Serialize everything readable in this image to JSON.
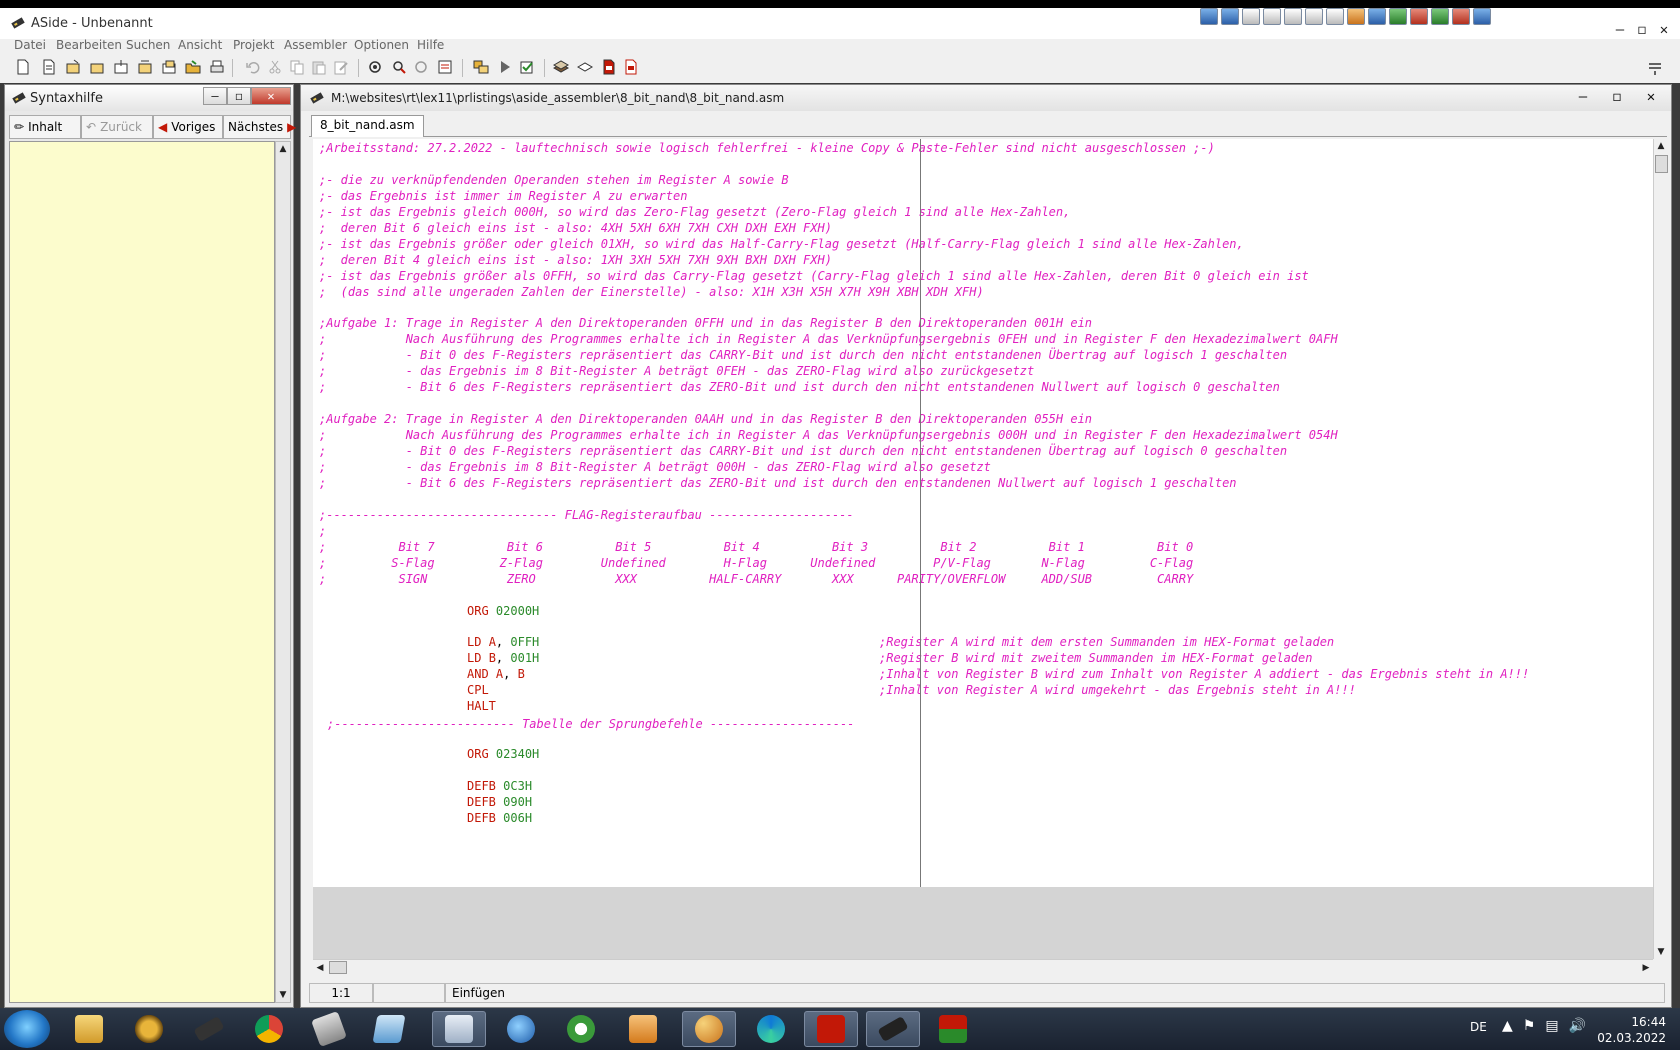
{
  "window": {
    "title": "ASide - Unbenannt"
  },
  "menu": [
    "Datei",
    "Bearbeiten",
    "Suchen",
    "Ansicht",
    "Projekt",
    "Assembler",
    "Optionen",
    "Hilfe"
  ],
  "syntax_panel": {
    "title": "Syntaxhilfe",
    "nav": {
      "contents": "Inhalt",
      "back": "Zurück",
      "previous": "Voriges",
      "next": "Nächstes"
    }
  },
  "editor": {
    "path": "M:\\websites\\rt\\lex11\\prlistings\\aside_assembler\\8_bit_nand\\8_bit_nand.asm",
    "tab": "8_bit_nand.asm",
    "comment_lines": [
      ";Arbeitsstand: 27.2.2022 - lauftechnisch sowie logisch fehlerfrei - kleine Copy & Paste-Fehler sind nicht ausgeschlossen ;-)",
      "",
      ";- die zu verknüpfendenden Operanden stehen im Register A sowie B",
      ";- das Ergebnis ist immer im Register A zu erwarten",
      ";- ist das Ergebnis gleich 000H, so wird das Zero-Flag gesetzt (Zero-Flag gleich 1 sind alle Hex-Zahlen,",
      ";  deren Bit 6 gleich eins ist - also: 4XH 5XH 6XH 7XH CXH DXH EXH FXH)",
      ";- ist das Ergebnis größer oder gleich 01XH, so wird das Half-Carry-Flag gesetzt (Half-Carry-Flag gleich 1 sind alle Hex-Zahlen,",
      ";  deren Bit 4 gleich eins ist - also: 1XH 3XH 5XH 7XH 9XH BXH DXH FXH)",
      ";- ist das Ergebnis größer als 0FFH, so wird das Carry-Flag gesetzt (Carry-Flag gleich 1 sind alle Hex-Zahlen, deren Bit 0 gleich ein ist",
      ";  (das sind alle ungeraden Zahlen der Einerstelle) - also: X1H X3H X5H X7H X9H XBH XDH XFH)",
      "",
      ";Aufgabe 1: Trage in Register A den Direktoperanden 0FFH und in das Register B den Direktoperanden 001H ein",
      ";           Nach Ausführung des Programmes erhalte ich in Register A das Verknüpfungsergebnis 0FEH und in Register F den Hexadezimalwert 0AFH",
      ";           - Bit 0 des F-Registers repräsentiert das CARRY-Bit und ist durch den nicht entstandenen Übertrag auf logisch 1 geschalten",
      ";           - das Ergebnis im 8 Bit-Register A beträgt 0FEH - das ZERO-Flag wird also zurückgesetzt",
      ";           - Bit 6 des F-Registers repräsentiert das ZERO-Bit und ist durch den nicht entstandenen Nullwert auf logisch 0 geschalten",
      "",
      ";Aufgabe 2: Trage in Register A den Direktoperanden 0AAH und in das Register B den Direktoperanden 055H ein",
      ";           Nach Ausführung des Programmes erhalte ich in Register A das Verknüpfungsergebnis 000H und in Register F den Hexadezimalwert 054H",
      ";           - Bit 0 des F-Registers repräsentiert das CARRY-Bit und ist durch den nicht entstandenen Übertrag auf logisch 0 geschalten",
      ";           - das Ergebnis im 8 Bit-Register A beträgt 000H - das ZERO-Flag wird also gesetzt",
      ";           - Bit 6 des F-Registers repräsentiert das ZERO-Bit und ist durch den entstandenen Nullwert auf logisch 1 geschalten",
      "",
      ";-------------------------------- FLAG-Registeraufbau --------------------",
      ";",
      ";          Bit 7          Bit 6          Bit 5          Bit 4          Bit 3          Bit 2          Bit 1          Bit 0",
      ";         S-Flag         Z-Flag        Undefined        H-Flag      Undefined        P/V-Flag       N-Flag         C-Flag",
      ";          SIGN           ZERO           XXX          HALF-CARRY       XXX      PARITY/OVERFLOW     ADD/SUB         CARRY"
    ],
    "code1": [
      {
        "mn": "ORG",
        "args": [
          {
            "t": "num",
            "v": "02000H"
          }
        ]
      },
      {
        "mn": "",
        "args": []
      },
      {
        "mn": "LD",
        "args": [
          {
            "t": "op",
            "v": "A"
          },
          {
            "t": "sep",
            "v": ", "
          },
          {
            "t": "num",
            "v": "0FFH"
          }
        ]
      },
      {
        "mn": "LD",
        "args": [
          {
            "t": "op",
            "v": "B"
          },
          {
            "t": "sep",
            "v": ", "
          },
          {
            "t": "num",
            "v": "001H"
          }
        ]
      },
      {
        "mn": "AND",
        "args": [
          {
            "t": "op",
            "v": "A"
          },
          {
            "t": "sep",
            "v": ", "
          },
          {
            "t": "op",
            "v": "B"
          }
        ]
      },
      {
        "mn": "CPL",
        "args": []
      },
      {
        "mn": "HALT",
        "args": []
      }
    ],
    "side_comments": [
      "",
      "",
      ";Register A wird mit dem ersten Summanden im HEX-Format geladen",
      ";Register B wird mit zweitem Summanden im HEX-Format geladen",
      ";Inhalt von Register B wird zum Inhalt von Register A addiert - das Ergebnis steht in A!!!",
      ";Inhalt von Register A wird umgekehrt - das Ergebnis steht in A!!!",
      ""
    ],
    "jump_table_header": ";------------------------- Tabelle der Sprungbefehle --------------------",
    "code2": [
      {
        "mn": "ORG",
        "args": [
          {
            "t": "num",
            "v": "02340H"
          }
        ]
      },
      {
        "mn": "",
        "args": []
      },
      {
        "mn": "DEFB",
        "args": [
          {
            "t": "num",
            "v": "0C3H"
          }
        ]
      },
      {
        "mn": "DEFB",
        "args": [
          {
            "t": "num",
            "v": "090H"
          }
        ]
      },
      {
        "mn": "DEFB",
        "args": [
          {
            "t": "num",
            "v": "006H"
          }
        ]
      }
    ],
    "status": {
      "position": "1:1",
      "mode": "Einfügen"
    }
  },
  "taskbar": {
    "language": "DE",
    "time": "16:44",
    "date": "02.03.2022",
    "items": [
      "explorer",
      "gear-app",
      "chip-app",
      "chrome",
      "files-app",
      "notepad-app",
      "calculator",
      "globe-app",
      "tools-app",
      "media-app",
      "paint-app",
      "edge",
      "p-app",
      "aside",
      "jkc-emu"
    ]
  }
}
